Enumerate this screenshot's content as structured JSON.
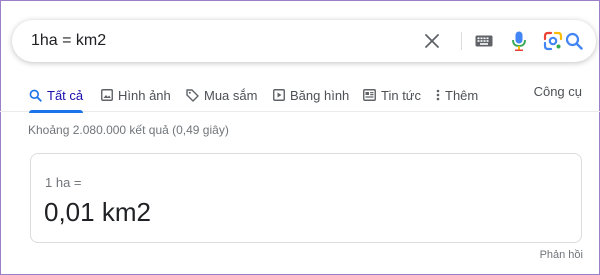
{
  "search": {
    "query": "1ha = km2"
  },
  "icons": {
    "clear": "close-icon",
    "keyboard": "keyboard-icon",
    "voice": "microphone-icon",
    "lens": "google-lens-icon",
    "search": "search-icon"
  },
  "tabs": [
    {
      "label": "Tất cả",
      "icon": "search-icon",
      "active": true
    },
    {
      "label": "Hình ảnh",
      "icon": "image-icon",
      "active": false
    },
    {
      "label": "Mua sắm",
      "icon": "tag-icon",
      "active": false
    },
    {
      "label": "Băng hình",
      "icon": "play-icon",
      "active": false
    },
    {
      "label": "Tin tức",
      "icon": "news-icon",
      "active": false
    },
    {
      "label": "Thêm",
      "icon": "more-vert-icon",
      "active": false
    }
  ],
  "tools_label": "Công cụ",
  "results_stats": "Khoảng 2.080.000 kết quả (0,49 giây)",
  "converter": {
    "equation": "1 ha =",
    "result": "0,01 km2"
  },
  "feedback_label": "Phản hồi",
  "colors": {
    "active_tab": "#1a0dab",
    "accent_blue": "#1a73e8",
    "frame": "#9b7fc9"
  }
}
